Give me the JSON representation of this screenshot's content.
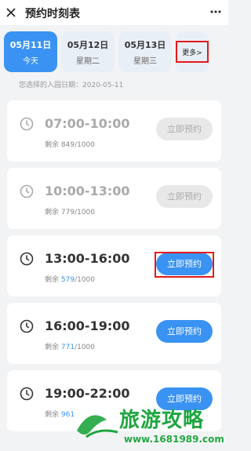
{
  "app": {
    "title": "预约时刻表"
  },
  "icons": {
    "close": "close-icon",
    "menu": "more-dots-icon",
    "clock": "clock-icon"
  },
  "dates": [
    {
      "date": "05月11日",
      "weekday": "今天",
      "active": true
    },
    {
      "date": "05月12日",
      "weekday": "星期二",
      "active": false
    },
    {
      "date": "05月13日",
      "weekday": "星期三",
      "active": false
    }
  ],
  "more_label": "更多>",
  "chosen_date_text": "您选择的入园日期：2020-05-11",
  "slots": [
    {
      "time": "07:00-10:00",
      "remain_prefix": "剩余 ",
      "remain_num": "849",
      "remain_total": "/1000",
      "button": "立即预约",
      "enabled": false
    },
    {
      "time": "10:00-13:00",
      "remain_prefix": "剩余 ",
      "remain_num": "779",
      "remain_total": "/1000",
      "button": "立即预约",
      "enabled": false
    },
    {
      "time": "13:00-16:00",
      "remain_prefix": "剩余 ",
      "remain_num": "579",
      "remain_total": "/1000",
      "button": "立即预约",
      "enabled": true
    },
    {
      "time": "16:00-19:00",
      "remain_prefix": "剩余 ",
      "remain_num": "771",
      "remain_total": "/1000",
      "button": "立即预约",
      "enabled": true
    },
    {
      "time": "19:00-22:00",
      "remain_prefix": "剩余 ",
      "remain_num": "961",
      "remain_total": "",
      "button": "立即预约",
      "enabled": true
    }
  ],
  "watermark": {
    "brand": "旅游攻略",
    "url": "www.1681989.com"
  },
  "colors": {
    "accent": "#3a93f2",
    "highlight": "#e21a1a",
    "disabled": "#e8e8e8",
    "watermark": "#1fa53f"
  }
}
